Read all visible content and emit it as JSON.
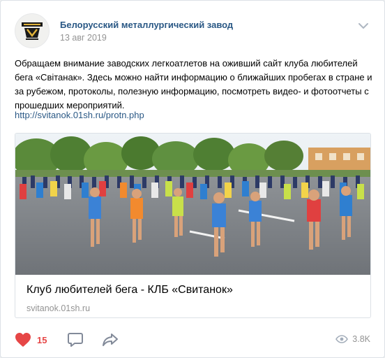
{
  "post": {
    "author": "Белорусский металлургический завод",
    "date": "13 авг 2019",
    "text": "Обращаем внимание заводских легкоатлетов на оживший сайт клуба любителей бега «Світанак». Здесь можно найти информацию о ближайших пробегах в стране и за рубежом, протоколы, полезную информацию, посмотреть видео- и фотоотчеты с прошедших мероприятий.",
    "link": "http://svitanok.01sh.ru/protn.php"
  },
  "card": {
    "title": "Клуб любителей бега - КЛБ «Свитанок»",
    "domain": "svitanok.01sh.ru"
  },
  "actions": {
    "likes": "15",
    "views": "3.8K"
  },
  "colors": {
    "link": "#2a5885",
    "muted": "#939393",
    "like": "#e64646",
    "icon": "#828a99"
  },
  "icons": [
    "avatar-logo",
    "chevron-down-icon",
    "heart-icon",
    "comment-icon",
    "share-icon",
    "eye-icon"
  ]
}
